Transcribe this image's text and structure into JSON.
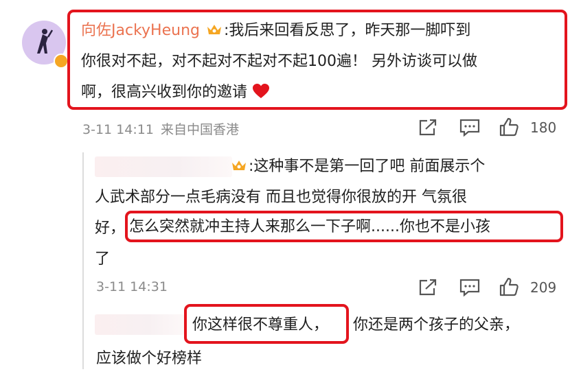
{
  "comment1": {
    "username": "向佐JackyHeung",
    "text_line1": ":我后来回看反思了，昨天那一脚吓到",
    "text_line2": "你很对不起，对不起对不起对不起100遍！ 另外访谈可以做",
    "text_line3": "啊，很高兴收到你的邀请",
    "time": "3-11 14:11",
    "location": "来自中国香港",
    "likes": "180"
  },
  "reply1": {
    "text_line1": ":这种事不是第一回了吧 前面展示个",
    "text_line2": "人武术部分一点毛病没有 而且也觉得你很放的开 气氛很",
    "text_prefix": "好，",
    "highlight": "怎么突然就冲主持人来那么一下子啊......你也不是小孩",
    "text_line4": "了",
    "time": "3-11 14:31",
    "likes": "209"
  },
  "reply2": {
    "highlight": "你这样很不尊重人，",
    "text_rest": "你还是两个孩子的父亲，",
    "text_line2": "应该做个好榜样"
  },
  "colors": {
    "username": "#eb7350",
    "highlight_border": "#e3141d",
    "heart": "#e3141d",
    "crown": "#f5a623",
    "avatar": "#d8c4ee"
  },
  "icons": [
    "crown-icon",
    "share-icon",
    "comment-icon",
    "like-icon",
    "heart-icon",
    "verified-icon"
  ]
}
